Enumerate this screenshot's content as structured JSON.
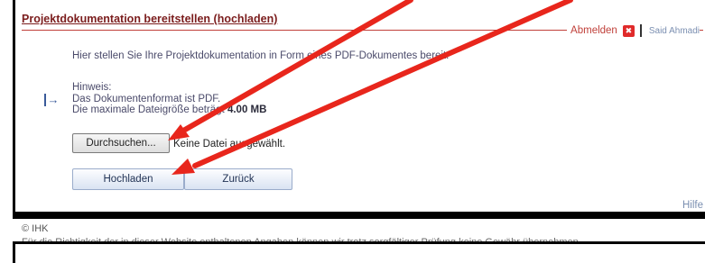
{
  "page": {
    "title": "Projektdokumentation bereitstellen (hochladen)",
    "intro": "Hier stellen Sie Ihre Projektdokumentation in Form eines PDF-Dokumentes bereit.",
    "hint_heading": "Hinweis:",
    "hint_format": "Das Dokumentenformat ist PDF.",
    "hint_size_prefix": "Die maximale Dateigröße beträgt",
    "hint_size_value": "4.00 MB",
    "help_label": "Hilfe"
  },
  "userbar": {
    "logout_label": "Abmelden",
    "username": "Said Ahmadi"
  },
  "upload": {
    "browse_label": "Durchsuchen...",
    "file_status": "Keine Datei ausgewählt.",
    "upload_label": "Hochladen",
    "back_label": "Zurück"
  },
  "footer": {
    "copyright": "© IHK",
    "disclaimer": "Für die Richtigkeit der in dieser Website enthaltenen Angaben können wir trotz sorgfältiger Prüfung keine Gewähr übernehmen."
  },
  "colors": {
    "annotation_arrow": "#e8261c",
    "title": "#7b1d1d"
  }
}
